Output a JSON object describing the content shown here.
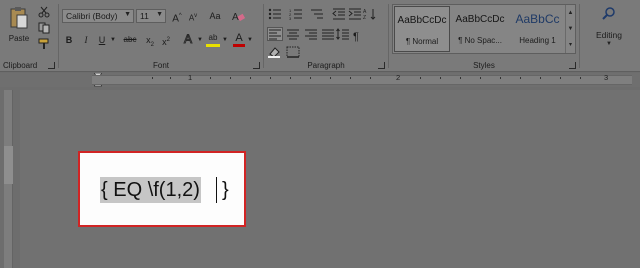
{
  "clipboard": {
    "paste_label": "Paste",
    "group_label": "Clipboard",
    "icons": [
      "cut-icon",
      "copy-icon",
      "format-painter-icon"
    ]
  },
  "font": {
    "group_label": "Font",
    "font_name": "Calibri (Body)",
    "font_size": "11",
    "grow_label": "A",
    "shrink_label": "A",
    "case_label": "Aa",
    "bold_label": "B",
    "italic_label": "I",
    "underline_label": "U",
    "strike_label": "abc",
    "subscript_label": "x",
    "superscript_label": "x",
    "effects_label": "A",
    "highlight_label": "ab",
    "color_label": "A",
    "highlight_color": "#e8e000",
    "font_color": "#c00000"
  },
  "paragraph": {
    "group_label": "Paragraph",
    "show_marks_label": "¶"
  },
  "styles": {
    "group_label": "Styles",
    "items": [
      {
        "sample": "AaBbCcDc",
        "name": "¶ Normal"
      },
      {
        "sample": "AaBbCcDc",
        "name": "¶ No Spac..."
      },
      {
        "sample": "AaBbCc",
        "name": "Heading 1"
      }
    ]
  },
  "editing": {
    "label": "Editing"
  },
  "ruler": {
    "numbers": [
      "1",
      "2",
      "3"
    ]
  },
  "document": {
    "field_code": "{ EQ \\f(1,2)",
    "field_close": "}"
  }
}
